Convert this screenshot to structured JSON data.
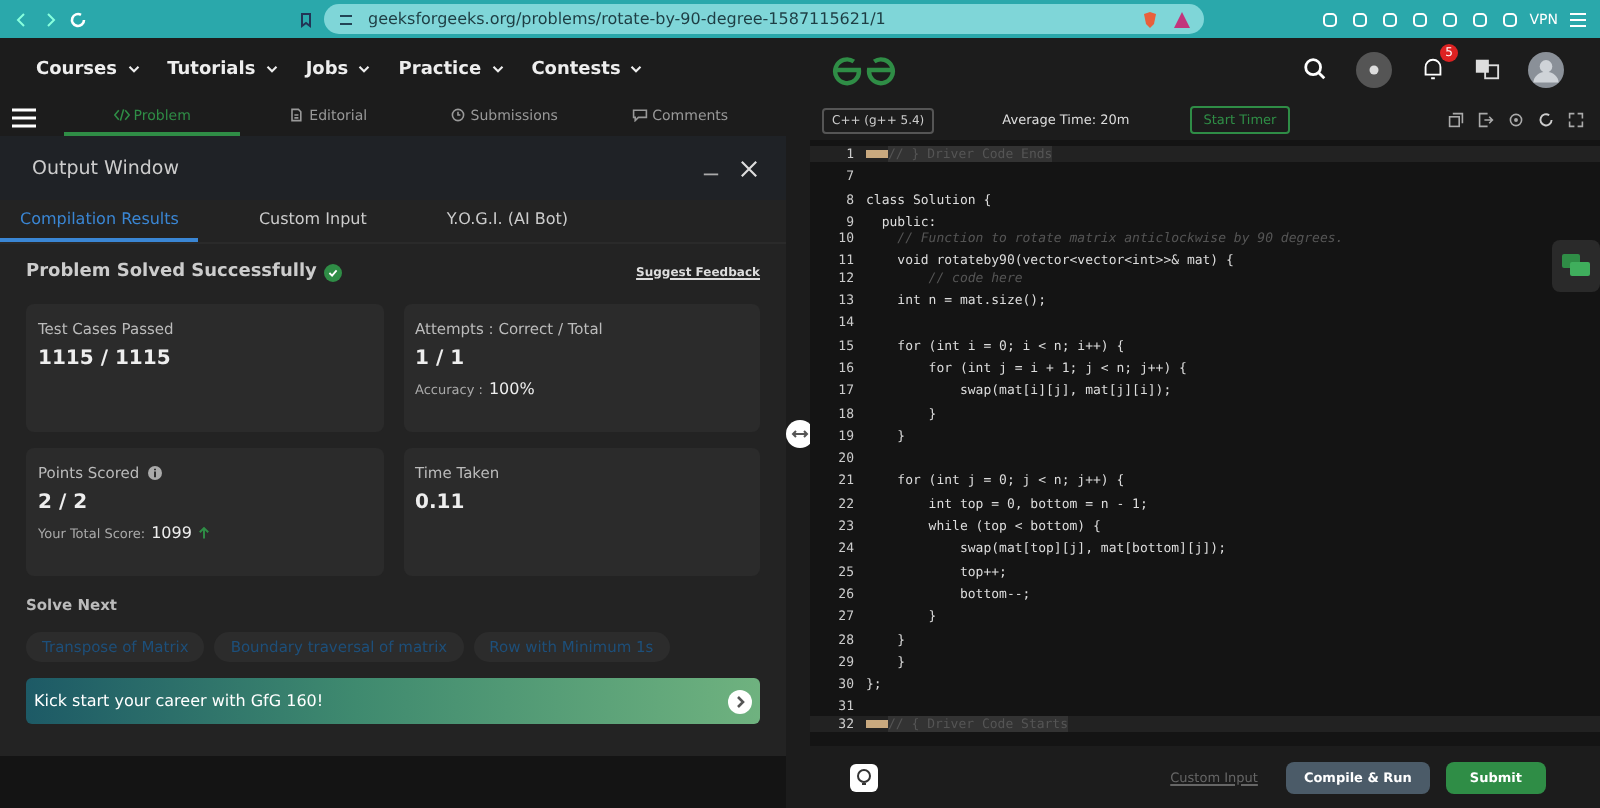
{
  "browser": {
    "url": "geeksforgeeks.org/problems/rotate-by-90-degree-1587115621/1",
    "vpn_label": "VPN"
  },
  "nav": {
    "items": [
      {
        "label": "Courses"
      },
      {
        "label": "Tutorials"
      },
      {
        "label": "Jobs"
      },
      {
        "label": "Practice"
      },
      {
        "label": "Contests"
      }
    ],
    "notification_count": "5"
  },
  "problem_tabs": [
    {
      "label": "Problem",
      "selected": true,
      "kind": "code"
    },
    {
      "label": "Editorial",
      "selected": false,
      "kind": "doc"
    },
    {
      "label": "Submissions",
      "selected": false,
      "kind": "clock"
    },
    {
      "label": "Comments",
      "selected": false,
      "kind": "chat"
    }
  ],
  "output_window": {
    "title": "Output Window",
    "tabs": [
      {
        "label": "Compilation Results",
        "selected": true
      },
      {
        "label": "Custom Input",
        "selected": false
      },
      {
        "label": "Y.O.G.I. (AI Bot)",
        "selected": false
      }
    ],
    "status": "Problem Solved Successfully",
    "feedback_link": "Suggest Feedback",
    "cards": [
      {
        "label": "Test Cases Passed",
        "value": "1115 / 1115",
        "info": false
      },
      {
        "label": "Attempts : Correct / Total",
        "value": "1 / 1",
        "sub_label": "Accuracy :",
        "sub_value": "100%",
        "info": false
      },
      {
        "label": "Points Scored",
        "value": "2 / 2",
        "sub_label": "Your Total Score:",
        "sub_value": "1099",
        "trend_up": true,
        "info": true
      },
      {
        "label": "Time Taken",
        "value": "0.11",
        "info": false
      }
    ],
    "solve_next": {
      "heading": "Solve Next",
      "items": [
        "Transpose of Matrix",
        "Boundary traversal of matrix",
        "Row with Minimum 1s"
      ]
    },
    "banner": "Kick start your career with GfG 160!"
  },
  "editor": {
    "language": "C++ (g++ 5.4)",
    "average_time": "Average Time: 20m",
    "timer_button": "Start Timer",
    "lines": [
      {
        "number": "1",
        "text": "// } Driver Code Ends",
        "kind": "folded"
      },
      {
        "number": "7",
        "kind": "code"
      },
      {
        "number": "8",
        "text": "class Solution {",
        "kind": "code"
      },
      {
        "number": "9",
        "text": "  public:",
        "kind": "code"
      },
      {
        "number": "10",
        "text": "    // Function to rotate matrix anticlockwise by 90 degrees.",
        "kind": "comment"
      },
      {
        "number": "11",
        "text": "    void rotateby90(vector<vector<int>>& mat) {",
        "kind": "code"
      },
      {
        "number": "12",
        "text": "        // code here",
        "kind": "comment"
      },
      {
        "number": "13",
        "text": "    int n = mat.size();",
        "kind": "code"
      },
      {
        "number": "14",
        "kind": "code"
      },
      {
        "number": "15",
        "text": "    for (int i = 0; i < n; i++) {",
        "kind": "code"
      },
      {
        "number": "16",
        "text": "        for (int j = i + 1; j < n; j++) {",
        "kind": "code"
      },
      {
        "number": "17",
        "text": "            swap(mat[i][j], mat[j][i]);",
        "kind": "code"
      },
      {
        "number": "18",
        "text": "        }",
        "kind": "code"
      },
      {
        "number": "19",
        "text": "    }",
        "kind": "code"
      },
      {
        "number": "20",
        "kind": "code"
      },
      {
        "number": "21",
        "text": "    for (int j = 0; j < n; j++) {",
        "kind": "code"
      },
      {
        "number": "22",
        "text": "        int top = 0, bottom = n - 1;",
        "kind": "code"
      },
      {
        "number": "23",
        "text": "        while (top < bottom) {",
        "kind": "code"
      },
      {
        "number": "24",
        "text": "            swap(mat[top][j], mat[bottom][j]);",
        "kind": "code"
      },
      {
        "number": "25",
        "text": "            top++;",
        "kind": "code"
      },
      {
        "number": "26",
        "text": "            bottom--;",
        "kind": "code"
      },
      {
        "number": "27",
        "text": "        }",
        "kind": "code"
      },
      {
        "number": "28",
        "text": "    }",
        "kind": "code"
      },
      {
        "number": "29",
        "text": "    }",
        "kind": "code"
      },
      {
        "number": "30",
        "text": "};",
        "kind": "code"
      },
      {
        "number": "31",
        "kind": "code"
      },
      {
        "number": "32",
        "text": "// { Driver Code Starts",
        "kind": "folded"
      }
    ],
    "custom_input": "Custom Input",
    "compile_button": "Compile & Run",
    "submit_button": "Submit"
  }
}
